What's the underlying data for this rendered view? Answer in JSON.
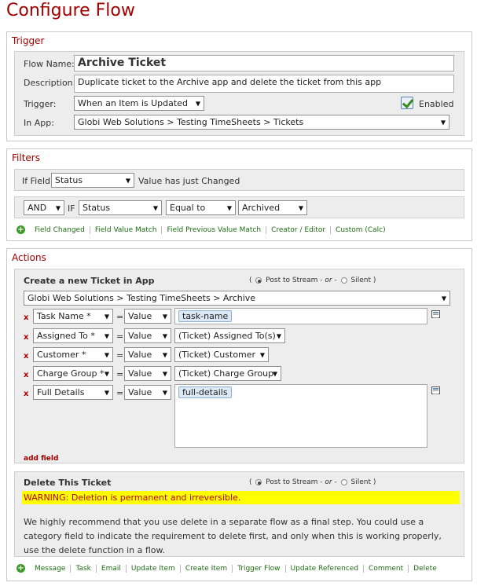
{
  "page": {
    "title": "Configure Flow"
  },
  "trigger": {
    "section_title": "Trigger",
    "flow_name_label": "Flow Name:",
    "flow_name_value": "Archive Ticket",
    "description_label": "Description:",
    "description_value": "Duplicate ticket to the Archive app and delete the ticket from this app",
    "trigger_label": "Trigger:",
    "trigger_value": "When an Item is Updated",
    "enabled_label": "Enabled",
    "enabled": true,
    "in_app_label": "In App:",
    "in_app_value": "Globi Web Solutions > Testing TimeSheets > Tickets"
  },
  "filters": {
    "section_title": "Filters",
    "if_field_label": "If Field",
    "if_field_value": "Status",
    "condition_text": "Value has just Changed",
    "row2": {
      "logic": "AND",
      "if_label": "IF",
      "field": "Status",
      "operator": "Equal to",
      "value": "Archived"
    },
    "links": [
      "Field Changed",
      "Field Value Match",
      "Field Previous Value Match",
      "Creator / Editor",
      "Custom (Calc)"
    ]
  },
  "actions": {
    "section_title": "Actions",
    "create": {
      "title": "Create a new Ticket in App",
      "post_open": "(",
      "post_to_stream": "Post to Stream",
      "or_text": "- or -",
      "silent": "Silent",
      "post_close": ")",
      "app_value": "Globi Web Solutions > Testing TimeSheets > Archive",
      "eq": "=",
      "remove": "x",
      "fields": [
        {
          "name": "Task Name *",
          "mode": "Value",
          "token": "task-name"
        },
        {
          "name": "Assigned To *",
          "mode": "Value",
          "target": "(Ticket) Assigned To(s)"
        },
        {
          "name": "Customer *",
          "mode": "Value",
          "target": "(Ticket) Customer"
        },
        {
          "name": "Charge Group *",
          "mode": "Value",
          "target": "(Ticket) Charge Group"
        },
        {
          "name": "Full Details",
          "mode": "Value",
          "token": "full-details"
        }
      ],
      "add_field": "add field"
    },
    "delete": {
      "title": "Delete This Ticket",
      "post_open": "(",
      "post_to_stream": "Post to Stream",
      "or_text": "- or -",
      "silent": "Silent",
      "post_close": ")",
      "warning": "WARNING: Deletion is permanent and irreversible.",
      "note": "We highly recommend that you use delete in a separate flow as a final step. You could use a category field to indicate the requirement to delete first, and only when this is working properly, use the delete function in a flow."
    },
    "links": [
      "Message",
      "Task",
      "Email",
      "Update Item",
      "Create Item",
      "Trigger Flow",
      "Update Referenced",
      "Comment",
      "Delete"
    ]
  },
  "icons": {
    "add": "plus-circle-icon",
    "dropdown": "chevron-down-icon",
    "field_picker": "field-list-icon",
    "remove": "remove-x-icon"
  },
  "colors": {
    "title_red": "#a00000",
    "link_green": "#1c6e12",
    "warning_bg": "#ffff00",
    "warning_text": "#c00000",
    "token_bg": "#dce9f5"
  }
}
